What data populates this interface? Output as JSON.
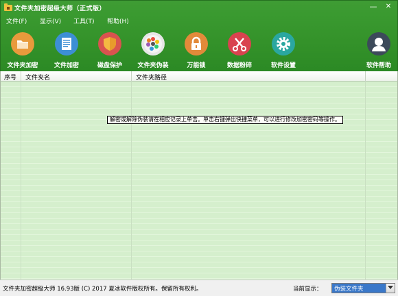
{
  "window": {
    "title": "文件夹加密超级大师（正式版）",
    "minimize_glyph": "—",
    "close_glyph": "✕"
  },
  "menu": [
    {
      "label": "文件(F)"
    },
    {
      "label": "显示(V)"
    },
    {
      "label": "工具(T)"
    },
    {
      "label": "帮助(H)"
    }
  ],
  "toolbar": [
    {
      "label": "文件夹加密",
      "icon": "folder-icon",
      "color": "#e89a3c"
    },
    {
      "label": "文件加密",
      "icon": "document-icon",
      "color": "#3d8fd4"
    },
    {
      "label": "磁盘保护",
      "icon": "shield-icon",
      "color": "#d9534f"
    },
    {
      "label": "文件夹伪装",
      "icon": "palette-icon",
      "color": "#e6e6e6"
    },
    {
      "label": "万能锁",
      "icon": "lock-icon",
      "color": "#e28a3a"
    },
    {
      "label": "数据粉碎",
      "icon": "scissors-icon",
      "color": "#d9434f"
    },
    {
      "label": "软件设置",
      "icon": "gear-icon",
      "color": "#2aa7a0"
    },
    {
      "label": "软件帮助",
      "icon": "user-icon",
      "color": "#3c4a5a"
    }
  ],
  "table": {
    "columns": [
      "序号",
      "文件夹名",
      "文件夹路径"
    ]
  },
  "tooltip": "解密或解除伪装请在相应记录上单击。单击右键弹出快捷菜单，可以进行修改加密密码等操作。",
  "status": {
    "text": "文件夹加密超级大师 16.93版 (C) 2017 夏冰软件版权所有。保留所有权利。",
    "view_label": "当前显示：",
    "view_value": "伪装文件夹"
  },
  "colors": {
    "chrome_green": "#34922a",
    "list_bg": "#d5efcd",
    "select_blue": "#3a78c9"
  }
}
